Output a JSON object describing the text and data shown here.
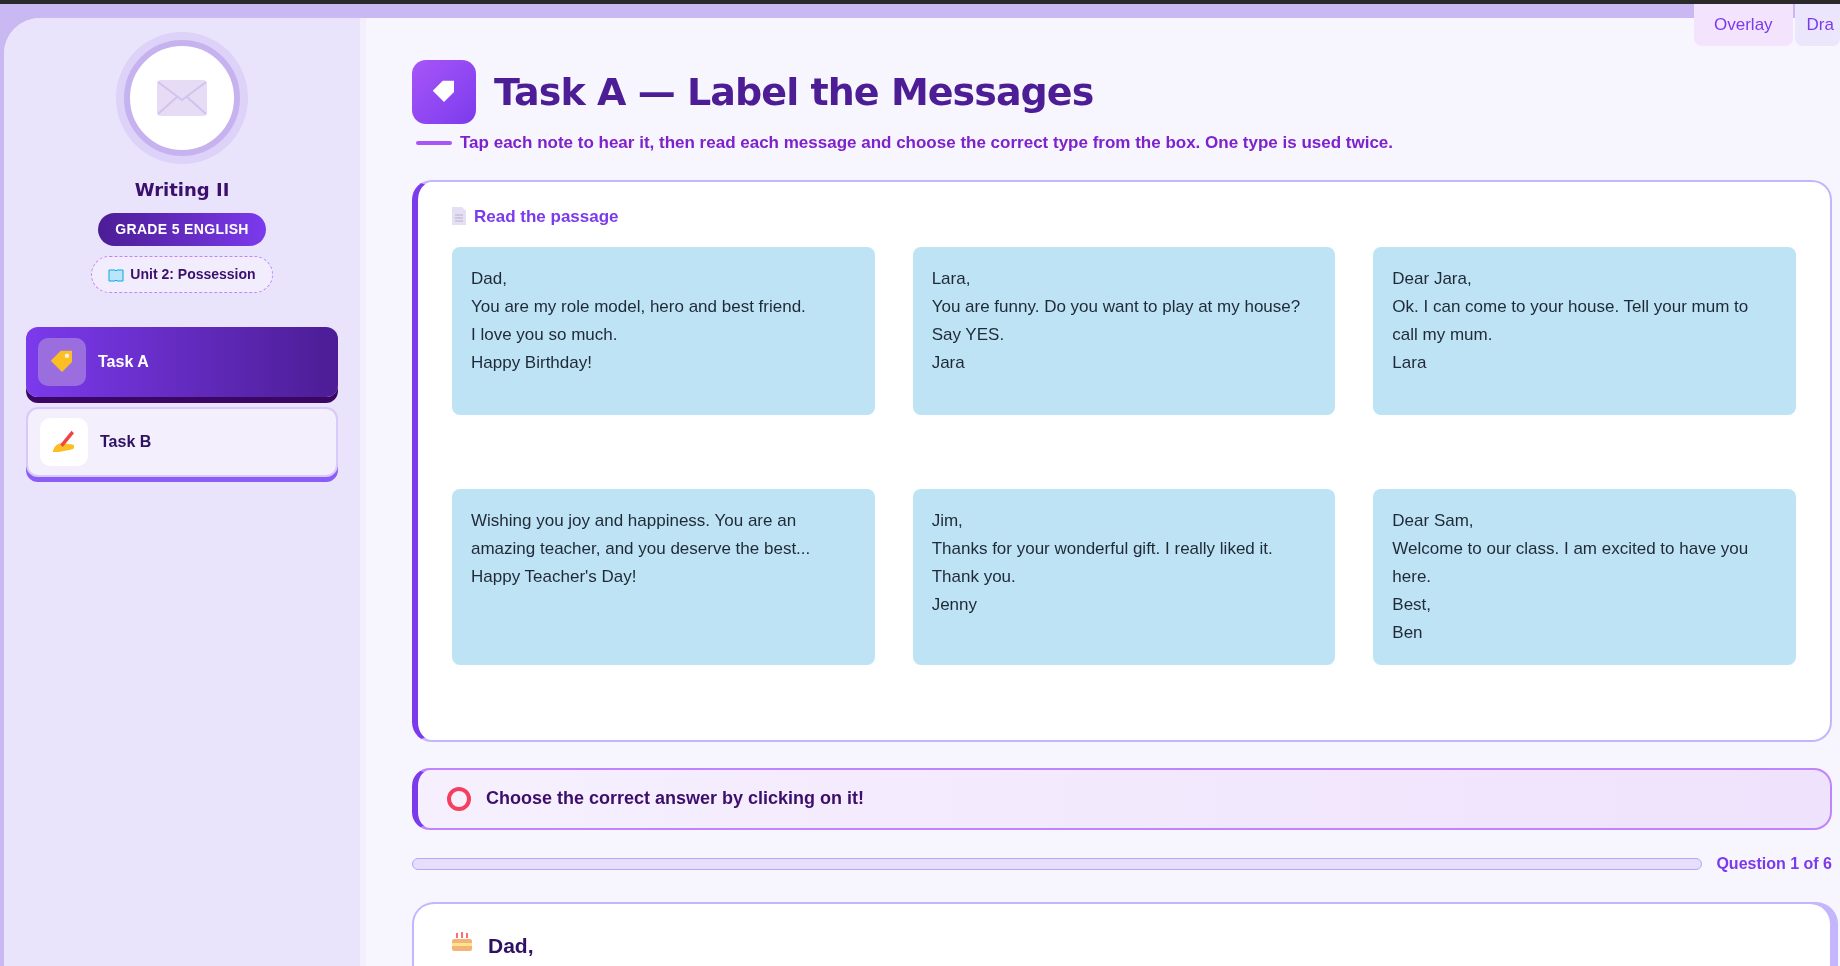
{
  "top_buttons": [
    {
      "label": "Overlay"
    },
    {
      "label": "Dra"
    }
  ],
  "sidebar": {
    "title": "Writing II",
    "grade": "GRADE 5 ENGLISH",
    "unit": "Unit 2: Possession",
    "tasks": [
      {
        "label": "Task A",
        "kind": "tag",
        "selected": true
      },
      {
        "label": "Task B",
        "kind": "writing",
        "selected": false
      }
    ]
  },
  "header": {
    "title": "Task A — Label the Messages",
    "instructions": "Tap each note to hear it, then read each message and choose the correct type from the box. One type is used twice."
  },
  "passage": {
    "heading": "Read the passage",
    "notes": [
      {
        "lines": [
          "Dad,",
          "You are my role model, hero and best friend.",
          "I love you so much.",
          "Happy Birthday!"
        ]
      },
      {
        "lines": [
          "Lara,",
          "You are funny. Do you want to play at my house? Say YES.",
          "Jara"
        ]
      },
      {
        "lines": [
          "Dear Jara,",
          "Ok. I can come to your house. Tell your mum to call my mum.",
          "Lara"
        ]
      },
      {
        "lines": [
          "Wishing you joy and happiness. You are an amazing teacher, and you deserve the best...",
          "Happy Teacher's Day!"
        ]
      },
      {
        "lines": [
          "Jim,",
          "Thanks for your wonderful gift. I really liked it.",
          "Thank you.",
          "Jenny"
        ]
      },
      {
        "lines": [
          "Dear Sam,",
          "Welcome to our class. I am excited to have you here.",
          "Best,",
          "Ben"
        ]
      }
    ]
  },
  "prompt": "Choose the correct answer by clicking on it!",
  "progress": {
    "label": "Question 1 of 6"
  },
  "question": {
    "title": "Dad,"
  }
}
